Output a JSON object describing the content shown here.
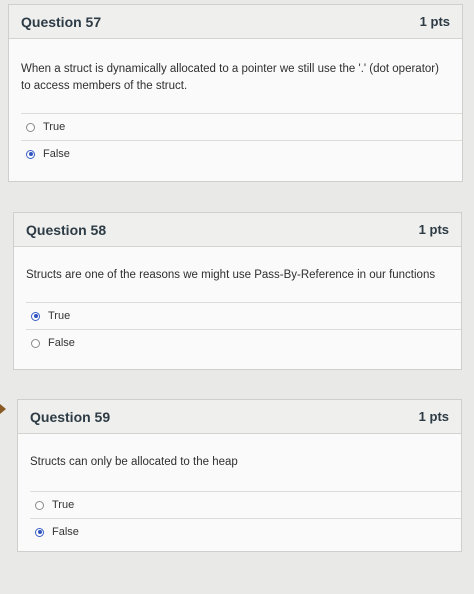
{
  "questions": [
    {
      "title": "Question 57",
      "points": "1 pts",
      "text": "When a struct is dynamically allocated to a pointer we still use the '.' (dot operator) to access members of the struct.",
      "answers": [
        {
          "label": "True",
          "selected": false
        },
        {
          "label": "False",
          "selected": true
        }
      ]
    },
    {
      "title": "Question 58",
      "points": "1 pts",
      "text": "Structs are one of the reasons we might use Pass-By-Reference in our functions",
      "answers": [
        {
          "label": "True",
          "selected": true
        },
        {
          "label": "False",
          "selected": false
        }
      ]
    },
    {
      "title": "Question 59",
      "points": "1 pts",
      "text": "Structs can only be allocated to the heap",
      "answers": [
        {
          "label": "True",
          "selected": false
        },
        {
          "label": "False",
          "selected": true
        }
      ]
    }
  ],
  "colors": {
    "accent_radio": "#2f55c0",
    "flag_marker": "#8a5a24"
  }
}
